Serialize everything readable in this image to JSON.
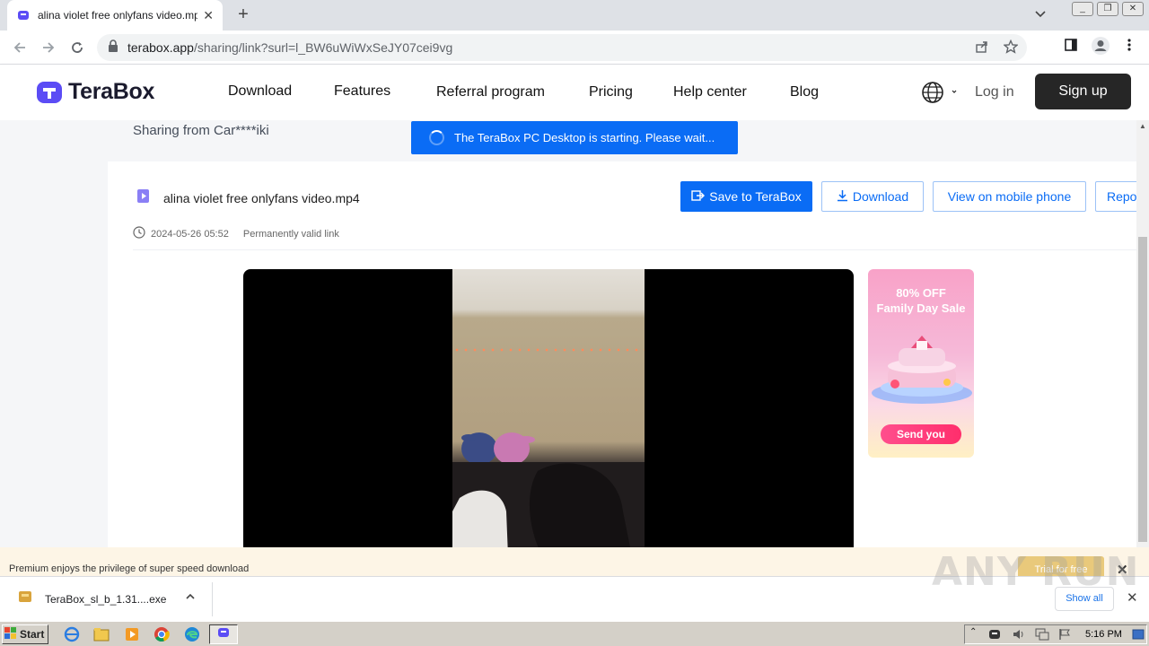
{
  "browser": {
    "tab_title": "alina violet free onlyfans video.mp4",
    "tab_close": "✕",
    "new_tab": "+",
    "url_host": "terabox.app",
    "url_path": "/sharing/link?surl=l_BW6uWiWxSeJY07cei9vg"
  },
  "site": {
    "brand": "TeraBox",
    "nav": {
      "download": "Download",
      "features": "Features",
      "referral": "Referral program",
      "pricing": "Pricing",
      "help": "Help center",
      "blog": "Blog"
    },
    "login": "Log in",
    "signup": "Sign up"
  },
  "share": {
    "from": "Sharing from Car****iki",
    "toast": "The TeraBox PC Desktop is starting. Please wait...",
    "file_name": "alina violet free onlyfans video.mp4",
    "date": "2024-05-26 05:52",
    "validity": "Permanently valid link",
    "save_button": "Save to TeraBox",
    "download_button": "Download",
    "mobile_button": "View on mobile phone",
    "report_button": "Repo"
  },
  "ad": {
    "title_line1": "80% OFF",
    "title_line2": "Family Day Sale",
    "button": "Send you"
  },
  "premium": {
    "text": "Premium enjoys the privilege of super speed download",
    "trial": "Trial for free"
  },
  "downloads": {
    "file": "TeraBox_sl_b_1.31....exe",
    "show_all": "Show all"
  },
  "watermark": "ANY RUN",
  "taskbar": {
    "start": "Start",
    "time": "5:16 PM"
  },
  "colors": {
    "brand_blue": "#0a6cf5",
    "logo_purple": "#5b4cf5",
    "signup_bg": "#262626"
  }
}
